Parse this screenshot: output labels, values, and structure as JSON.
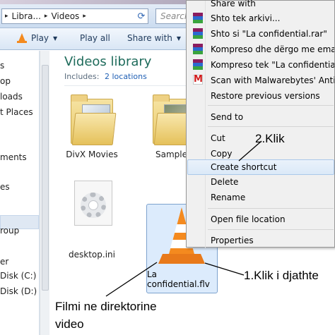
{
  "address": {
    "crumbs": [
      "Libra...",
      "Videos"
    ],
    "search_placeholder": "Search"
  },
  "toolbar": {
    "play_label": "Play",
    "play_all_label": "Play all",
    "share_with_label": "Share with"
  },
  "nav_pane": {
    "items": [
      "s",
      "op",
      "loads",
      "t Places",
      "ments",
      "es",
      "roup",
      "er",
      "Disk (C:)",
      "Disk (D:)"
    ]
  },
  "library": {
    "title": "Videos library",
    "includes_label": "Includes:",
    "locations_link": "2 locations"
  },
  "files": [
    {
      "name": "DivX Movies"
    },
    {
      "name": "Sample"
    },
    {
      "name": "desktop.ini"
    },
    {
      "name": "La confidential.flv"
    }
  ],
  "context_menu": {
    "items": [
      {
        "label": "Share with",
        "icon": ""
      },
      {
        "label": "Shto tek arkivi...",
        "icon": "winrar-icon"
      },
      {
        "label": "Shto si \"La confidential.rar\"",
        "icon": "winrar-icon"
      },
      {
        "label": "Kompreso dhe dërgo me email...",
        "icon": "winrar-icon"
      },
      {
        "label": "Kompreso tek \"La confidential.rar\"",
        "icon": "winrar-icon"
      },
      {
        "label": "Scan with Malwarebytes' Anti-Malware",
        "icon": "malwarebytes-icon"
      },
      {
        "label": "Restore previous versions",
        "icon": ""
      },
      {
        "label": "Send to",
        "icon": ""
      },
      {
        "label": "Cut",
        "icon": ""
      },
      {
        "label": "Copy",
        "icon": ""
      },
      {
        "label": "Create shortcut",
        "icon": ""
      },
      {
        "label": "Delete",
        "icon": ""
      },
      {
        "label": "Rename",
        "icon": ""
      },
      {
        "label": "Open file location",
        "icon": ""
      },
      {
        "label": "Properties",
        "icon": ""
      }
    ]
  },
  "annotations": {
    "step2": "2.Klik",
    "step1": "1.Klik i djathte",
    "note_line1": "Filmi ne direktorine",
    "note_line2": "video"
  },
  "colors": {
    "library_title": "#1e6b5b",
    "link": "#1f5fb4",
    "selection": "#dcebfc",
    "vlc_orange": "#f48a1f"
  }
}
